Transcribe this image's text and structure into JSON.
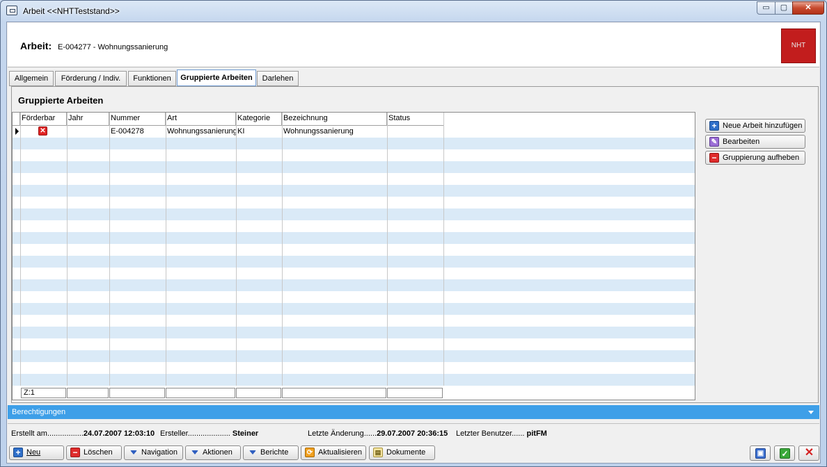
{
  "window": {
    "title": "Arbeit  <<NHTTeststand>>",
    "minimize": "▭",
    "maximize": "▢",
    "close": "✕"
  },
  "header": {
    "label": "Arbeit:",
    "value": "E-004277 - Wohnungssanierung",
    "logo_text": "NHT"
  },
  "tabs": [
    {
      "label": "Allgemein"
    },
    {
      "label": "Förderung / Indiv."
    },
    {
      "label": "Funktionen"
    },
    {
      "label": "Gruppierte Arbeiten",
      "active": true
    },
    {
      "label": "Darlehen"
    }
  ],
  "panel": {
    "title": "Gruppierte Arbeiten"
  },
  "grid": {
    "columns": [
      "Förderbar",
      "Jahr",
      "Nummer",
      "Art",
      "Kategorie",
      "Bezeichnung",
      "Status"
    ],
    "rows": [
      {
        "foerderbar": "✕",
        "jahr": "",
        "nummer": "E-004278",
        "art": "Wohnungssanierung",
        "kategorie": "KI",
        "bezeichnung": "Wohnungssanierung",
        "status": ""
      }
    ],
    "footer_count": "Z:1"
  },
  "side_buttons": {
    "add": "Neue Arbeit hinzufügen",
    "edit": "Bearbeiten",
    "ungroup": "Gruppierung aufheben"
  },
  "permissions": {
    "label": "Berechtigungen"
  },
  "info": {
    "created_label": "Erstellt am.................",
    "created_value": "24.07.2007 12:03:10",
    "creator_label": "Ersteller....................",
    "creator_value": "Steiner",
    "changed_label": "Letzte Änderung......",
    "changed_value": "29.07.2007 20:36:15",
    "last_user_label": "Letzter Benutzer......",
    "last_user_value": "pitFM"
  },
  "toolbar": {
    "new": "Neu",
    "delete": "Löschen",
    "navigation": "Navigation",
    "actions": "Aktionen",
    "reports": "Berichte",
    "refresh": "Aktualisieren",
    "documents": "Dokumente"
  },
  "colors": {
    "accent_blue": "#3e9fe8",
    "row_alt": "#daeaf7",
    "logo_red": "#c21d1d"
  }
}
